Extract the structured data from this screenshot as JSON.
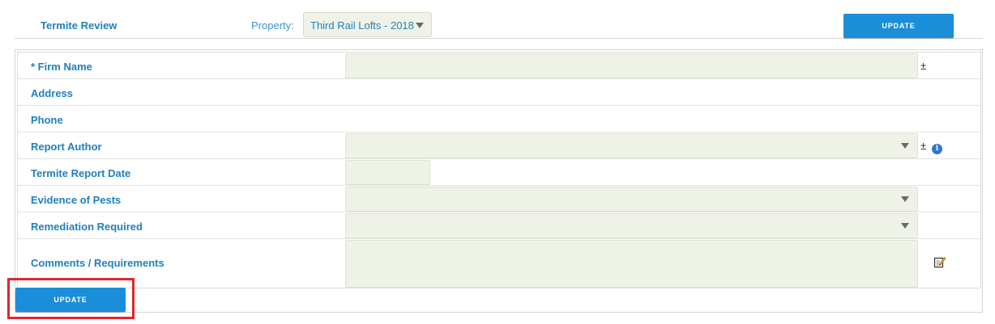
{
  "header": {
    "title": "Termite Review",
    "property_label": "Property:",
    "property_value": "Third Rail Lofts - 2018",
    "update_label": "UPDATE"
  },
  "form": {
    "rows": [
      {
        "label": "* Firm Name",
        "control": "text",
        "extras": [
          "±"
        ]
      },
      {
        "label": "Address",
        "control": "none"
      },
      {
        "label": "Phone",
        "control": "none"
      },
      {
        "label": "Report Author",
        "control": "select",
        "extras": [
          "±",
          "info-icon"
        ]
      },
      {
        "label": "Termite Report Date",
        "control": "date"
      },
      {
        "label": "Evidence of Pests",
        "control": "select"
      },
      {
        "label": "Remediation Required",
        "control": "select"
      },
      {
        "label": "Comments / Requirements",
        "control": "textarea",
        "extras": [
          "edit-icon"
        ]
      }
    ],
    "plus_minus": "±",
    "info_glyph": "i"
  },
  "footer": {
    "update_label": "UPDATE"
  },
  "colors": {
    "accent": "#1b8ed9",
    "label_blue": "#1f7fbf",
    "field_bg": "#eff3e7",
    "highlight": "#e3262a"
  }
}
